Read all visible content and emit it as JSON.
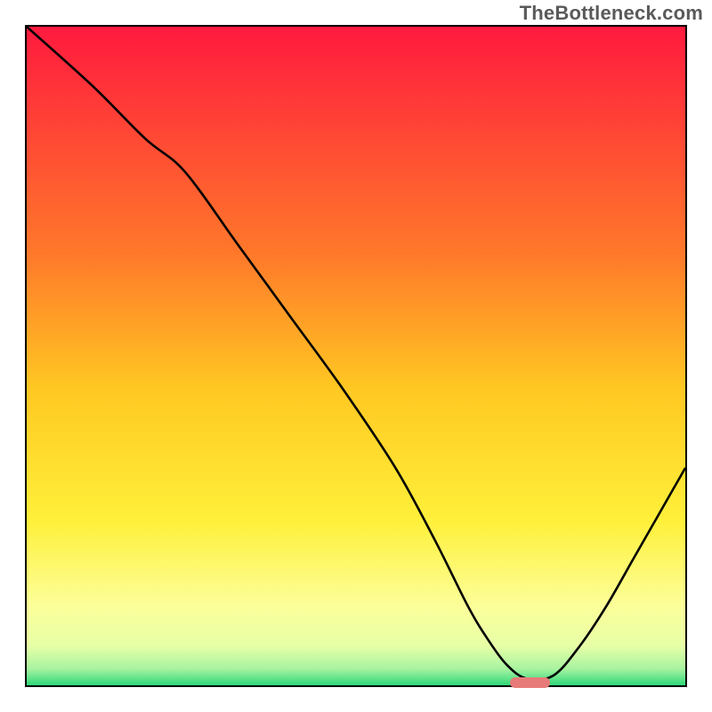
{
  "watermark": "TheBottleneck.com",
  "chart_data": {
    "type": "line",
    "title": "",
    "xlabel": "",
    "ylabel": "",
    "xlim": [
      0,
      100
    ],
    "ylim": [
      0,
      100
    ],
    "grid": false,
    "legend": false,
    "background_gradient": {
      "stops": [
        {
          "pos": 0.0,
          "color": "#ff1a3e"
        },
        {
          "pos": 0.35,
          "color": "#ff7a2a"
        },
        {
          "pos": 0.55,
          "color": "#ffc822"
        },
        {
          "pos": 0.75,
          "color": "#fff03a"
        },
        {
          "pos": 0.88,
          "color": "#fcff9a"
        },
        {
          "pos": 0.94,
          "color": "#e7ffa6"
        },
        {
          "pos": 0.975,
          "color": "#a8f3a0"
        },
        {
          "pos": 1.0,
          "color": "#2fd87a"
        }
      ]
    },
    "series": [
      {
        "name": "bottleneck-curve",
        "x": [
          0,
          10,
          18,
          24,
          32,
          40,
          48,
          56,
          62,
          67,
          70,
          73,
          76,
          80,
          84,
          88,
          92,
          96,
          100
        ],
        "y": [
          100,
          91,
          83,
          78,
          67,
          56,
          45,
          33,
          22,
          12,
          7,
          3,
          1,
          1.5,
          6,
          12,
          19,
          26,
          33
        ]
      }
    ],
    "marker": {
      "name": "bottleneck-target",
      "x_start": 73,
      "x_end": 79,
      "y": 1,
      "color": "#e77b79"
    }
  }
}
